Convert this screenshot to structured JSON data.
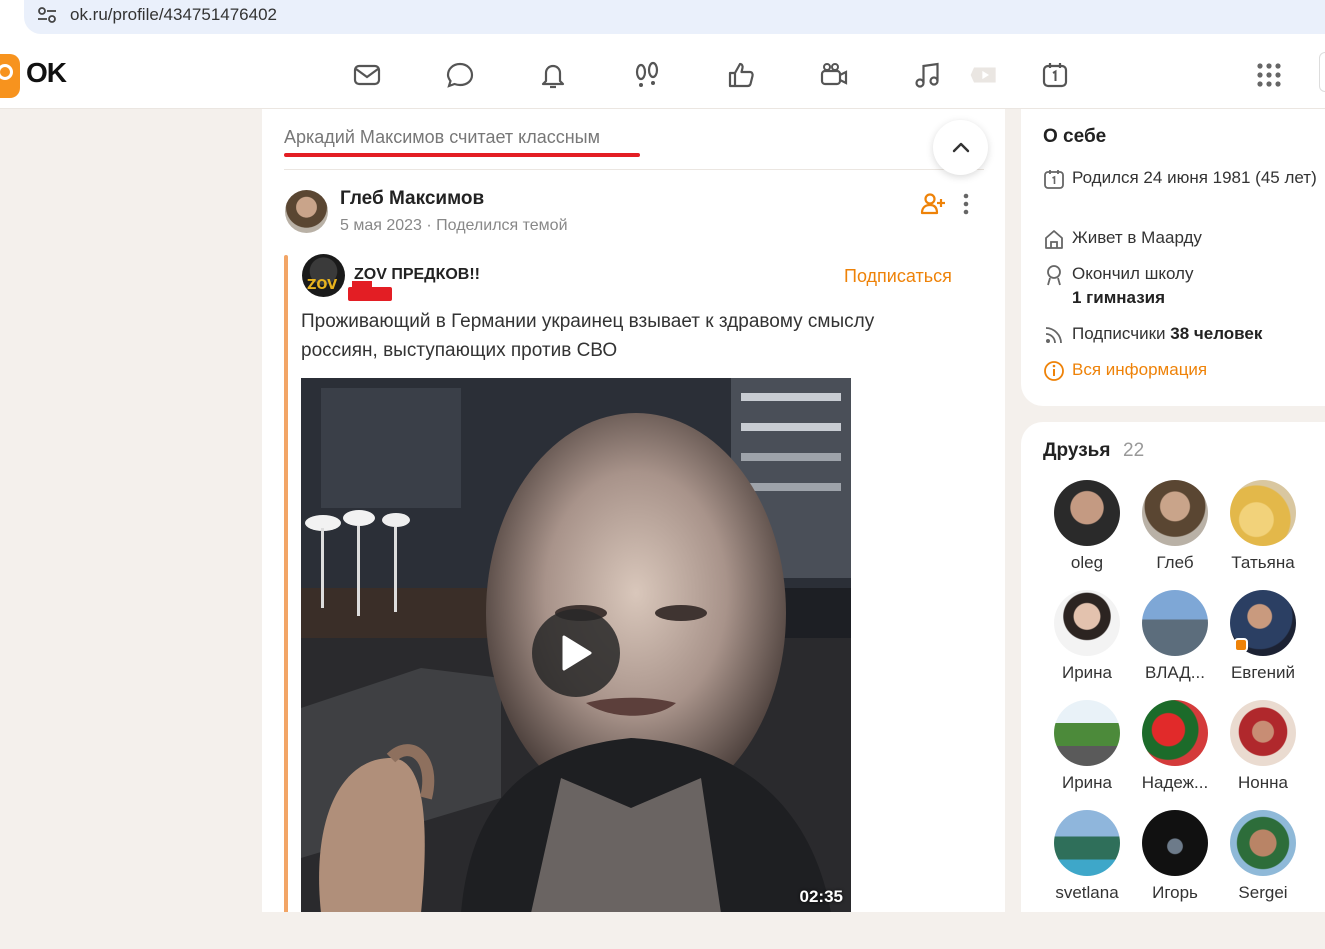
{
  "browser": {
    "url": "ok.ru/profile/434751476402"
  },
  "header": {
    "logo_text": "OK",
    "nav_icons": [
      "mail-icon",
      "chat-icon",
      "bell-icon",
      "guests-icon",
      "likes-icon",
      "video-camera-icon",
      "music-icon",
      "play-icon",
      "calendar-icon",
      "apps-grid-icon"
    ],
    "accent_color": "#ee8208"
  },
  "feed": {
    "heading": "Аркадий Максимов считает классным",
    "post": {
      "author": "Глеб Максимов",
      "meta": "5 мая 2023 · Поделился темой",
      "shared": {
        "group_name": "ZOV ПРЕДКОВ!!",
        "subscribe_label": "Подписаться",
        "text": "Проживающий в Германии украинец взывает к здравому смыслу россиян, выступающих против СВО",
        "video_duration": "02:35"
      }
    }
  },
  "about": {
    "title": "О себе",
    "born": "Родился 24 июня 1981 (45 лет)",
    "lives": "Живет в Маарду",
    "school_label": "Окончил школу",
    "school_name": "1 гимназия",
    "followers_label": "Подписчики",
    "followers_value": "38 человек",
    "all_info": "Вся информация"
  },
  "friends": {
    "title": "Друзья",
    "count": "22",
    "items": [
      {
        "name": "oleg"
      },
      {
        "name": "Глеб"
      },
      {
        "name": "Татьяна"
      },
      {
        "name": "Ирина"
      },
      {
        "name": "ВЛАД..."
      },
      {
        "name": "Евгений"
      },
      {
        "name": "Ирина"
      },
      {
        "name": "Надеж..."
      },
      {
        "name": "Нонна"
      },
      {
        "name": "svetlana"
      },
      {
        "name": "Игорь"
      },
      {
        "name": "Sergei"
      }
    ]
  }
}
